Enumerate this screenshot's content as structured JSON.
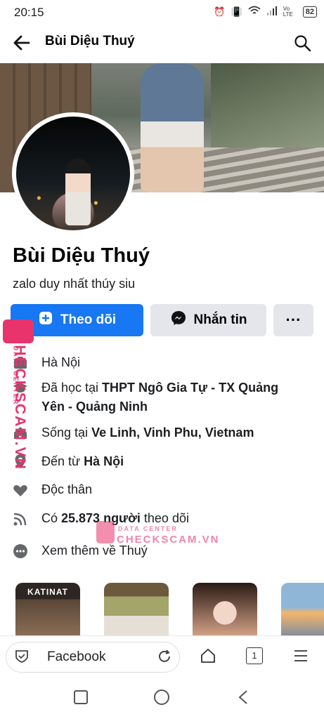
{
  "status_bar": {
    "time": "20:15",
    "battery": "82",
    "network": "Vo LTE"
  },
  "header": {
    "title": "Bùi Diệu Thuý"
  },
  "profile": {
    "name": "Bùi Diệu Thuý",
    "bio": "zalo duy nhất thúy siu"
  },
  "buttons": {
    "follow": "Theo dõi",
    "message": "Nhắn tin",
    "more": "···"
  },
  "info": {
    "work_place": "Hà Nội",
    "studied_prefix": "Đã học tại ",
    "studied_school": "THPT Ngô Gia Tự - TX Quảng Yên - Quảng Ninh",
    "lives_prefix": "Sống tại ",
    "lives_place": "Ve Linh, Vinh Phu, Vietnam",
    "from_prefix": "Đến từ ",
    "from_place": "Hà Nội",
    "relationship": "Độc thân",
    "followers_prefix": "Có ",
    "followers_count": "25.873 người",
    "followers_suffix": " theo dõi",
    "see_more": "Xem thêm về Thuý"
  },
  "thumbnails": [
    {
      "caption": "KATINAT"
    }
  ],
  "browser": {
    "url_label": "Facebook",
    "tab_count": "1"
  },
  "watermark": {
    "brand": "CHECKSCAM.VN",
    "tag": "DATA CENTER"
  }
}
